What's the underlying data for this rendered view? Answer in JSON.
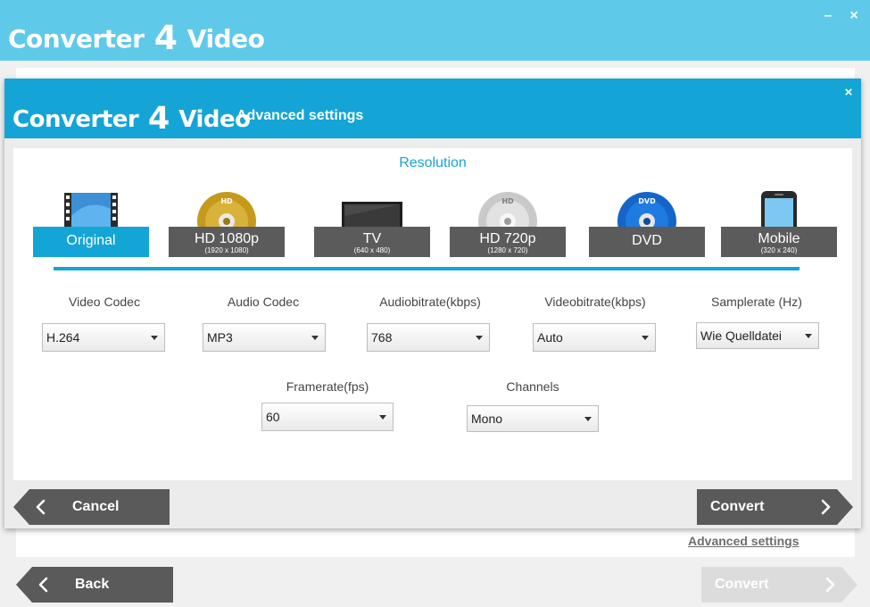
{
  "app": {
    "title_part1": "Converter",
    "title_number": "4",
    "title_part2": "Video",
    "minimize_glyph": "–",
    "close_glyph": "×"
  },
  "background": {
    "advanced_link": "Advanced settings",
    "back_label": "Back",
    "convert_label": "Convert"
  },
  "dialog": {
    "title_part1": "Converter",
    "title_number": "4",
    "title_part2": "Video",
    "subtitle": "Advanced settings",
    "close_glyph": "×",
    "resolution_title": "Resolution",
    "presets": [
      {
        "name": "Original",
        "sub": "",
        "icon": "film-strip-icon",
        "selected": true
      },
      {
        "name": "HD 1080p",
        "sub": "(1920 x 1080)",
        "icon": "gold-hd-disc-icon",
        "selected": false
      },
      {
        "name": "TV",
        "sub": "(640 x 480)",
        "icon": "tv-icon",
        "selected": false
      },
      {
        "name": "HD 720p",
        "sub": "(1280 x 720)",
        "icon": "silver-hd-disc-icon",
        "selected": false
      },
      {
        "name": "DVD",
        "sub": "",
        "icon": "dvd-disc-icon",
        "selected": false
      },
      {
        "name": "Mobile",
        "sub": "(320 x 240)",
        "icon": "mobile-phone-icon",
        "selected": false
      }
    ],
    "fields": {
      "video_codec": {
        "label": "Video Codec",
        "value": "H.264"
      },
      "audio_codec": {
        "label": "Audio Codec",
        "value": "MP3"
      },
      "audio_bitrate": {
        "label": "Audiobitrate(kbps)",
        "value": "768"
      },
      "video_bitrate": {
        "label": "Videobitrate(kbps)",
        "value": "Auto"
      },
      "samplerate": {
        "label": "Samplerate (Hz)",
        "value": "Wie Quelldatei"
      },
      "framerate": {
        "label": "Framerate(fps)",
        "value": "60"
      },
      "channels": {
        "label": "Channels",
        "value": "Mono"
      }
    },
    "cancel_label": "Cancel",
    "convert_label": "Convert"
  },
  "colors": {
    "titlebar": "#5fc9ea",
    "dialog_header": "#14a5d6",
    "accent": "#13a5d5",
    "button_dark": "#5a5a5a",
    "button_disabled": "#dcdcdc"
  }
}
